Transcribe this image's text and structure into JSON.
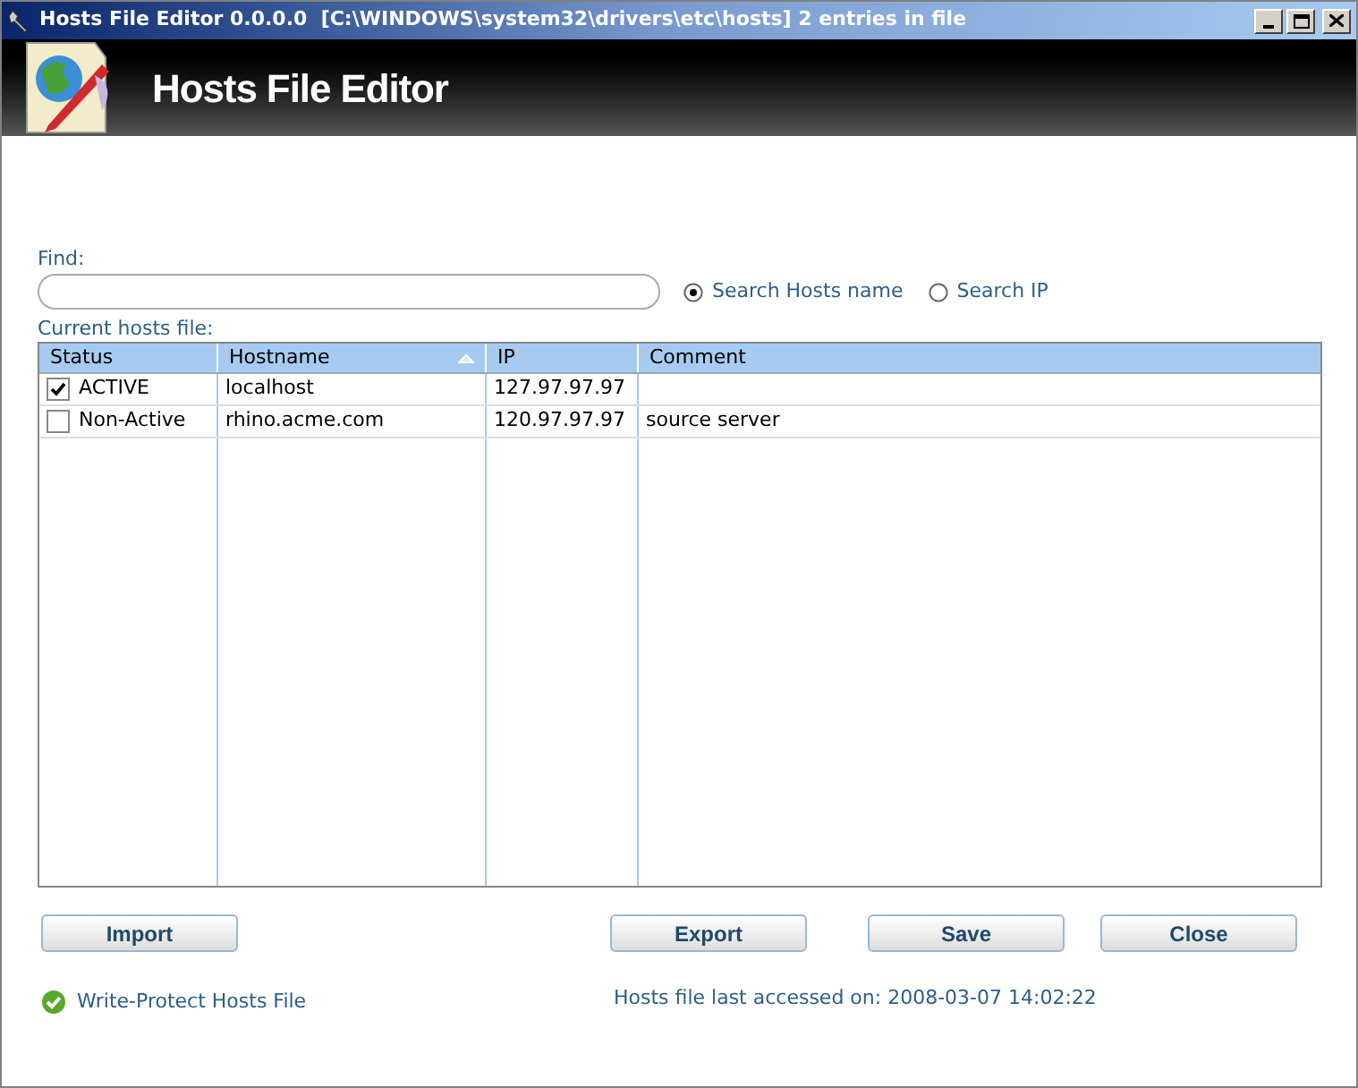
{
  "window": {
    "title": "Hosts File Editor 0.0.0.0  [C:\\WINDOWS\\system32\\drivers\\etc\\hosts] 2 entries in file"
  },
  "banner": {
    "title": "Hosts File Editor"
  },
  "find": {
    "label": "Find:",
    "options": [
      {
        "label": "Search Hosts name",
        "selected": true
      },
      {
        "label": "Search IP",
        "selected": false
      }
    ]
  },
  "table": {
    "label": "Current hosts file:",
    "columns": [
      {
        "label": "Status",
        "sorted": false
      },
      {
        "label": "Hostname",
        "sorted": true
      },
      {
        "label": "IP",
        "sorted": false
      },
      {
        "label": "Comment",
        "sorted": false
      }
    ],
    "rows": [
      {
        "checked": true,
        "status": "ACTIVE",
        "hostname": "localhost",
        "ip": "127.97.97.97",
        "comment": ""
      },
      {
        "checked": false,
        "status": "Non-Active",
        "hostname": "rhino.acme.com",
        "ip": "120.97.97.97",
        "comment": "source server"
      }
    ]
  },
  "buttons": [
    "Import",
    "Export",
    "Save",
    "Close"
  ],
  "write_protect": {
    "label": "Write-Protect Hosts File",
    "checked": true
  },
  "last_accessed": "Hosts file last accessed on: 2008-03-07 14:02:22"
}
